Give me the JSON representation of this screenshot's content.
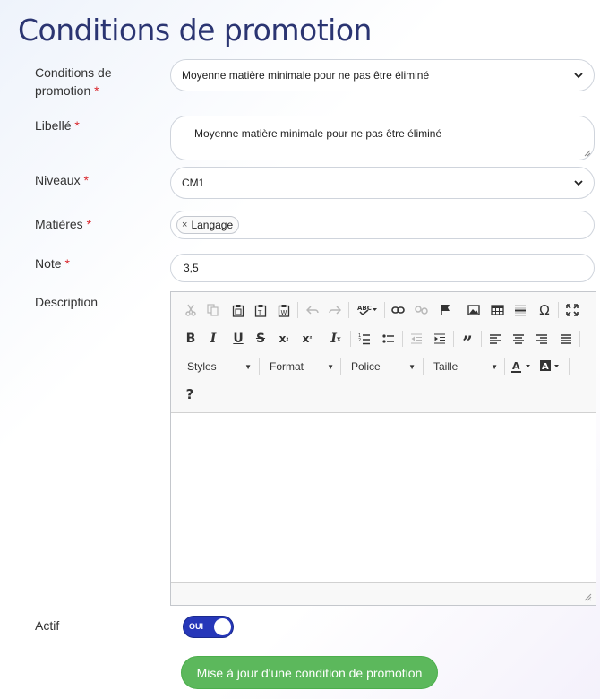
{
  "page": {
    "title": "Conditions de promotion"
  },
  "form": {
    "condition": {
      "label_line1": "Conditions de",
      "label_line2": "promotion",
      "required": "*",
      "value": "Moyenne matière minimale pour ne pas être éliminé"
    },
    "libelle": {
      "label": "Libellé",
      "required": "*",
      "value": "Moyenne matière minimale pour ne pas être éliminé"
    },
    "niveaux": {
      "label": "Niveaux",
      "required": "*",
      "value": "CM1"
    },
    "matieres": {
      "label": "Matières",
      "required": "*",
      "tags": [
        "Langage"
      ],
      "remove_glyph": "×"
    },
    "note": {
      "label": "Note",
      "required": "*",
      "value": "3,5"
    },
    "description": {
      "label": "Description",
      "toolbar": {
        "combos": [
          "Styles",
          "Format",
          "Police",
          "Taille"
        ],
        "help": "?",
        "icons": [
          "cut-icon",
          "copy-icon",
          "paste-icon",
          "paste-text-icon",
          "paste-word-icon",
          "undo-icon",
          "redo-icon",
          "spellcheck-icon",
          "link-icon",
          "unlink-icon",
          "anchor-icon",
          "image-icon",
          "table-icon",
          "horizontal-rule-icon",
          "special-char-icon",
          "maximize-icon",
          "bold-icon",
          "italic-icon",
          "underline-icon",
          "strike-icon",
          "subscript-icon",
          "superscript-icon",
          "remove-format-icon",
          "numbered-list-icon",
          "bulleted-list-icon",
          "outdent-icon",
          "indent-icon",
          "blockquote-icon",
          "align-left-icon",
          "align-center-icon",
          "align-right-icon",
          "justify-icon",
          "text-color-icon",
          "bg-color-icon"
        ]
      },
      "content": ""
    },
    "actif": {
      "label": "Actif",
      "toggle_text": "OUI",
      "checked": true
    }
  },
  "submit": {
    "label": "Mise à jour d'une condition de promotion"
  },
  "colors": {
    "title": "#2b3572",
    "required": "#d9262c",
    "toggle": "#2637b9",
    "button": "#5cb85c"
  }
}
